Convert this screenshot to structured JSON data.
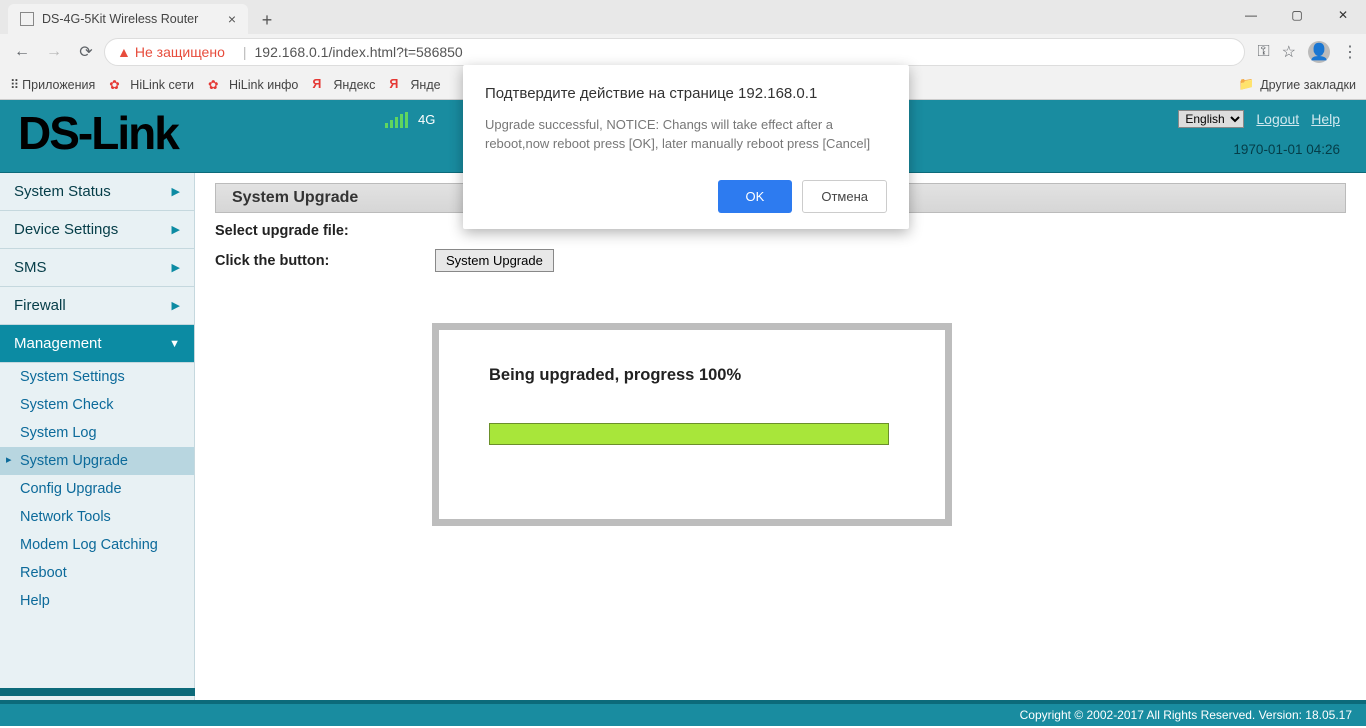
{
  "browser": {
    "tab_title": "DS-4G-5Kit Wireless Router",
    "insecure_label": "Не защищено",
    "url": "192.168.0.1/index.html?t=586850",
    "apps_label": "Приложения",
    "bookmarks": [
      "HiLink сети",
      "HiLink инфо",
      "Яндекс",
      "Янде"
    ],
    "other_bookmarks": "Другие закладки"
  },
  "header": {
    "logo": "DS-Link",
    "mode": "4G",
    "lang": "English",
    "logout": "Logout",
    "help": "Help",
    "datetime": "1970-01-01 04:26"
  },
  "sidebar": {
    "categories": [
      {
        "label": "System Status"
      },
      {
        "label": "Device Settings"
      },
      {
        "label": "SMS"
      },
      {
        "label": "Firewall"
      },
      {
        "label": "Management"
      }
    ],
    "mgmt_items": [
      "System Settings",
      "System Check",
      "System Log",
      "System Upgrade",
      "Config Upgrade",
      "Network Tools",
      "Modem Log Catching",
      "Reboot",
      "Help"
    ]
  },
  "content": {
    "panel_title": "System Upgrade",
    "select_file_label": "Select upgrade file:",
    "click_button_label": "Click the button:",
    "upgrade_button": "System Upgrade"
  },
  "progress": {
    "text": "Being upgraded, progress 100%"
  },
  "dialog": {
    "title": "Подтвердите действие на странице 192.168.0.1",
    "body": "Upgrade successful, NOTICE: Changs will take effect after a reboot,now reboot press [OK], later manually reboot press [Cancel]",
    "ok": "OK",
    "cancel": "Отмена"
  },
  "footer": "Copyright © 2002-2017 All Rights Reserved. Version: 18.05.17"
}
